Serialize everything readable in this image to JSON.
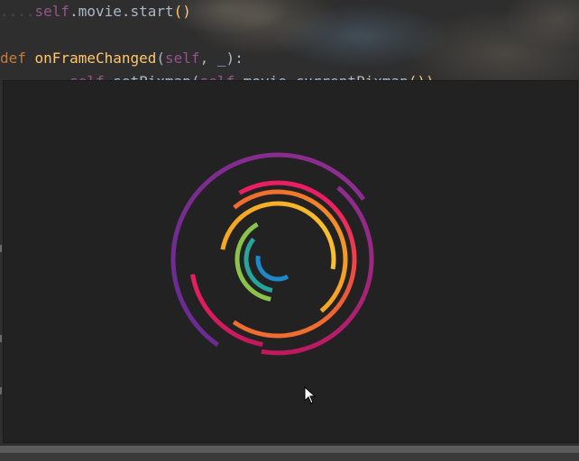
{
  "editor": {
    "lines": [
      {
        "indent": "....",
        "parts": [
          {
            "text": "self",
            "kind": "self"
          },
          {
            "text": ".movie.start",
            "kind": "plain"
          },
          {
            "text": "()",
            "kind": "hl-paren"
          }
        ]
      },
      {
        "indent": "",
        "parts": []
      },
      {
        "indent": "",
        "parts": [
          {
            "text": "def ",
            "kind": "kw"
          },
          {
            "text": "onFrameChanged",
            "kind": "fn"
          },
          {
            "text": "(",
            "kind": "plain"
          },
          {
            "text": "self",
            "kind": "self"
          },
          {
            "text": ", _):",
            "kind": "plain"
          }
        ]
      },
      {
        "indent": "........",
        "parts": [
          {
            "text": "self",
            "kind": "self"
          },
          {
            "text": ".setPixmap(",
            "kind": "plain"
          },
          {
            "text": "self",
            "kind": "self"
          },
          {
            "text": ".movie.currentPixmap",
            "kind": "plain"
          },
          {
            "text": "())",
            "kind": "hl-paren"
          }
        ]
      }
    ]
  },
  "spinner": {
    "colors": [
      "#6a2c91",
      "#8e2c8f",
      "#c2185b",
      "#e91e63",
      "#f06c2f",
      "#f5a623",
      "#fbc02d",
      "#8bc34a",
      "#26a69a",
      "#1e88c8"
    ]
  },
  "cursor_icon": "arrow-cursor-icon"
}
